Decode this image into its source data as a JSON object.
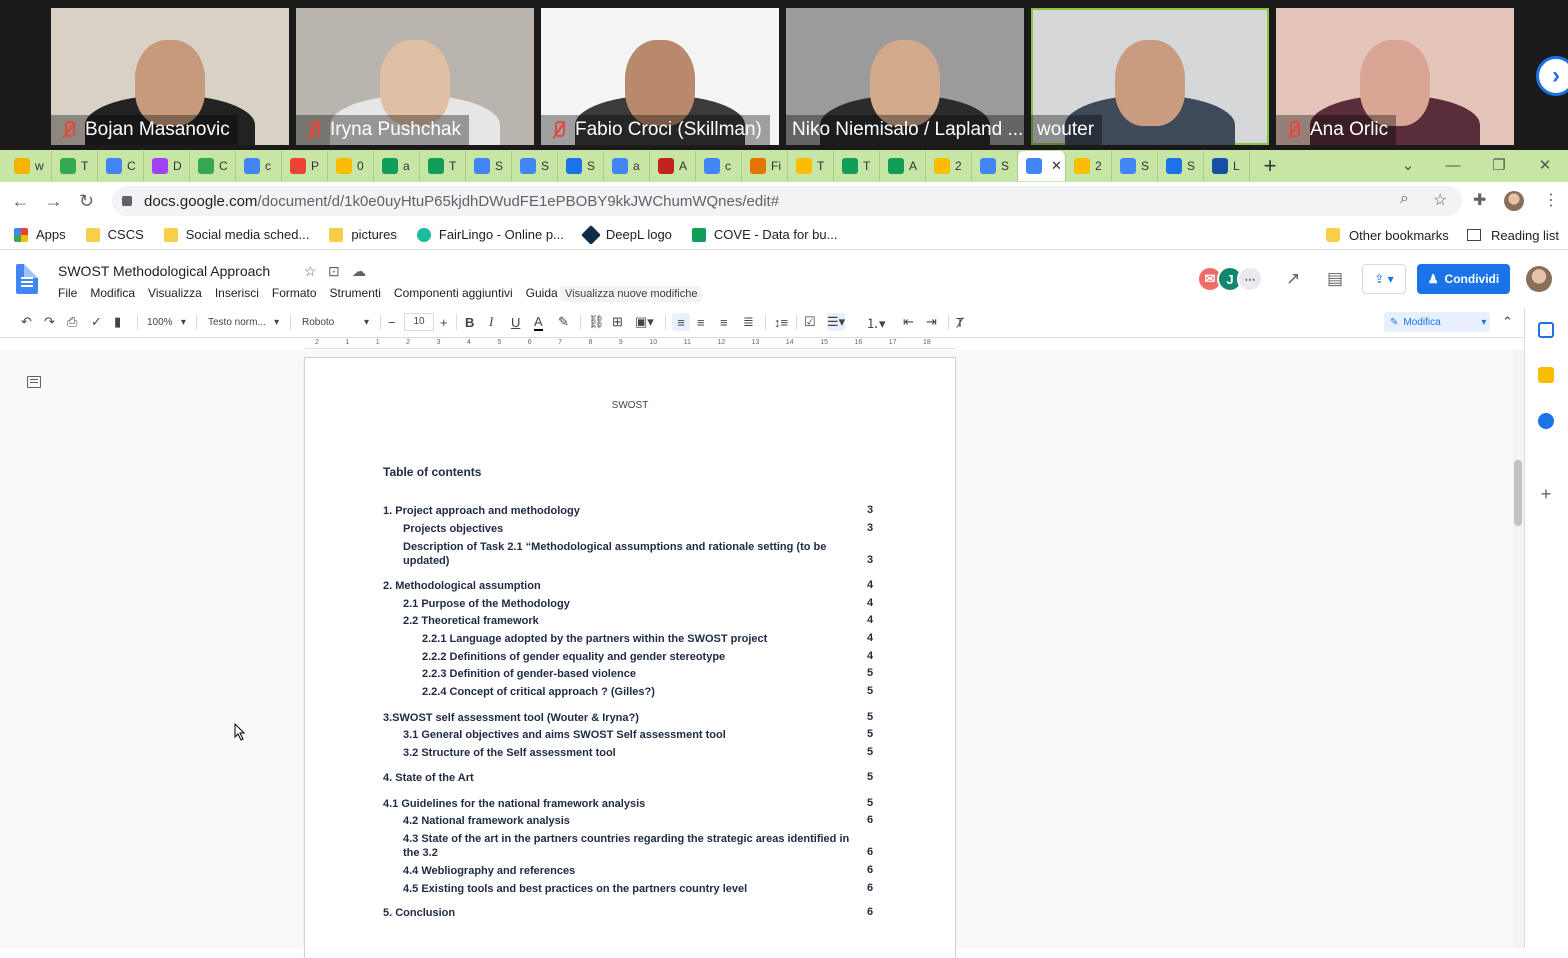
{
  "video_call": {
    "participants": [
      {
        "name": "Bojan Masanovic",
        "muted": true,
        "bg": "#d8d2c6",
        "skin": "#c79a7c",
        "shirt": "#222222"
      },
      {
        "name": "Iryna Pushchak",
        "muted": true,
        "bg": "#b9b4ad",
        "skin": "#e0c0a5",
        "shirt": "#e6e6e6"
      },
      {
        "name": "Fabio Croci (Skillman)",
        "muted": true,
        "bg": "#f4f4f4",
        "skin": "#b8896c",
        "shirt": "#3b3b3b"
      },
      {
        "name": "Niko Niemisalo / Lapland ...",
        "muted": false,
        "bg": "#9b9b9b",
        "skin": "#d3a98c",
        "shirt": "#2b2b2b"
      },
      {
        "name": "wouter",
        "muted": false,
        "bg": "#d5d7d9",
        "skin": "#c99c80",
        "shirt": "#3e4a5a",
        "active": true
      },
      {
        "name": "Ana Orlic",
        "muted": true,
        "bg": "#e5c4b9",
        "skin": "#d9a594",
        "shirt": "#5a2d3a"
      }
    ]
  },
  "browser": {
    "tabs": [
      {
        "letter": "w",
        "color": "#f4b400"
      },
      {
        "letter": "T",
        "color": "#34a853"
      },
      {
        "letter": "C",
        "color": "#4285f4"
      },
      {
        "letter": "D",
        "color": "#a142f4"
      },
      {
        "letter": "C",
        "color": "#34a853"
      },
      {
        "letter": "c",
        "color": "#4285f4"
      },
      {
        "letter": "P",
        "color": "#ea4335"
      },
      {
        "letter": "0",
        "color": "#fbbc04"
      },
      {
        "letter": "a",
        "color": "#0f9d58"
      },
      {
        "letter": "T",
        "color": "#0f9d58"
      },
      {
        "letter": "S",
        "color": "#4285f4"
      },
      {
        "letter": "S",
        "color": "#4285f4"
      },
      {
        "letter": "S",
        "color": "#1a73e8"
      },
      {
        "letter": "a",
        "color": "#4285f4"
      },
      {
        "letter": "A",
        "color": "#c5221f"
      },
      {
        "letter": "c",
        "color": "#4285f4"
      },
      {
        "letter": "Fi",
        "color": "#e37400"
      },
      {
        "letter": "T",
        "color": "#fbbc04"
      },
      {
        "letter": "T",
        "color": "#0f9d58"
      },
      {
        "letter": "A",
        "color": "#0f9d58"
      },
      {
        "letter": "2",
        "color": "#fbbc04"
      },
      {
        "letter": "S",
        "color": "#4285f4"
      },
      {
        "letter": "",
        "color": "#4285f4",
        "active": true
      },
      {
        "letter": "2",
        "color": "#fbbc04"
      },
      {
        "letter": "S",
        "color": "#4285f4"
      },
      {
        "letter": "S",
        "color": "#1a73e8"
      },
      {
        "letter": "L",
        "color": "#174ea6"
      }
    ],
    "url_host": "docs.google.com",
    "url_path": "/document/d/1k0e0uyHtuP65kjdhDWudFE1ePBOBY9kkJWChumWQnes/edit#",
    "bookmarks": [
      {
        "label": "Apps",
        "icon": "apps-grid-icon"
      },
      {
        "label": "CSCS",
        "icon": "folder-icon"
      },
      {
        "label": "Social media sched...",
        "icon": "folder-icon"
      },
      {
        "label": "pictures",
        "icon": "folder-icon"
      },
      {
        "label": "FairLingo - Online p...",
        "icon": "fairlingo-icon"
      },
      {
        "label": "DeepL logo",
        "icon": "deepl-icon"
      },
      {
        "label": "COVE - Data for bu...",
        "icon": "cove-icon"
      }
    ],
    "other_bookmarks": "Other bookmarks",
    "reading_list": "Reading list"
  },
  "docs": {
    "title": "SWOST Methodological Approach",
    "menu": [
      "File",
      "Modifica",
      "Visualizza",
      "Inserisci",
      "Formato",
      "Strumenti",
      "Componenti aggiuntivi",
      "Guida"
    ],
    "last_edit": "Visualizza nuove modifiche",
    "collaborator_initial": "J",
    "share_label": "Condividi",
    "toolbar": {
      "zoom": "100%",
      "style": "Testo norm...",
      "font": "Roboto",
      "font_size": "10",
      "mode": "Modifica"
    },
    "ruler_marks": [
      "2",
      "1",
      "1",
      "2",
      "3",
      "4",
      "5",
      "6",
      "7",
      "8",
      "9",
      "10",
      "11",
      "12",
      "13",
      "14",
      "15",
      "16",
      "17",
      "18"
    ],
    "page": {
      "header": "SWOST",
      "toc_title": "Table of contents",
      "toc": [
        {
          "text": "1.  Project approach and methodology",
          "page": "3",
          "level": 0,
          "bold": true
        },
        {
          "text": "Projects objectives",
          "page": "3",
          "level": 1,
          "bold": true
        },
        {
          "text": "Description of Task 2.1 “Methodological assumptions and rationale setting (to be updated)",
          "page": "3",
          "level": 1,
          "bold": true
        },
        {
          "text": "2. Methodological assumption",
          "page": "4",
          "level": 0,
          "bold": true
        },
        {
          "text": "2.1 Purpose of the Methodology",
          "page": "4",
          "level": 1,
          "bold": true
        },
        {
          "text": "2.2 Theoretical framework",
          "page": "4",
          "level": 1,
          "bold": true
        },
        {
          "text": "2.2.1 Language adopted by the partners within the SWOST project",
          "page": "4",
          "level": 2,
          "bold": true
        },
        {
          "text": "2.2.2 Definitions of gender equality and gender stereotype",
          "page": "4",
          "level": 2,
          "bold": true
        },
        {
          "text": "2.2.3 Definition of gender-based violence",
          "page": "5",
          "level": 2,
          "bold": true
        },
        {
          "text": "2.2.4 Concept of critical approach ? (Gilles?)",
          "page": "5",
          "level": 2,
          "bold": true
        },
        {
          "text": "3.SWOST self assessment tool (Wouter & Iryna?)",
          "page": "5",
          "level": 0,
          "bold": true
        },
        {
          "text": "3.1  General objectives and aims SWOST Self assessment tool",
          "page": "5",
          "level": 1,
          "bold": true
        },
        {
          "text": "3.2 Structure of the Self assessment tool",
          "page": "5",
          "level": 1,
          "bold": true
        },
        {
          "text": "4. State of the Art",
          "page": "5",
          "level": 0,
          "bold": true
        },
        {
          "text": "4.1 Guidelines for the national framework analysis",
          "page": "5",
          "level": 0,
          "bold": true
        },
        {
          "text": "4.2 National framework analysis",
          "page": "6",
          "level": 1,
          "bold": true
        },
        {
          "text": "4.3 State of the art in the partners countries regarding the strategic areas identified in the 3.2",
          "page": "6",
          "level": 1,
          "bold": true
        },
        {
          "text": "4.4 Webliography and references",
          "page": "6",
          "level": 1,
          "bold": true
        },
        {
          "text": "4.5  Existing tools and best practices on the partners country level",
          "page": "6",
          "level": 1,
          "bold": true
        },
        {
          "text": "5. Conclusion",
          "page": "6",
          "level": 0,
          "bold": true
        }
      ]
    }
  }
}
